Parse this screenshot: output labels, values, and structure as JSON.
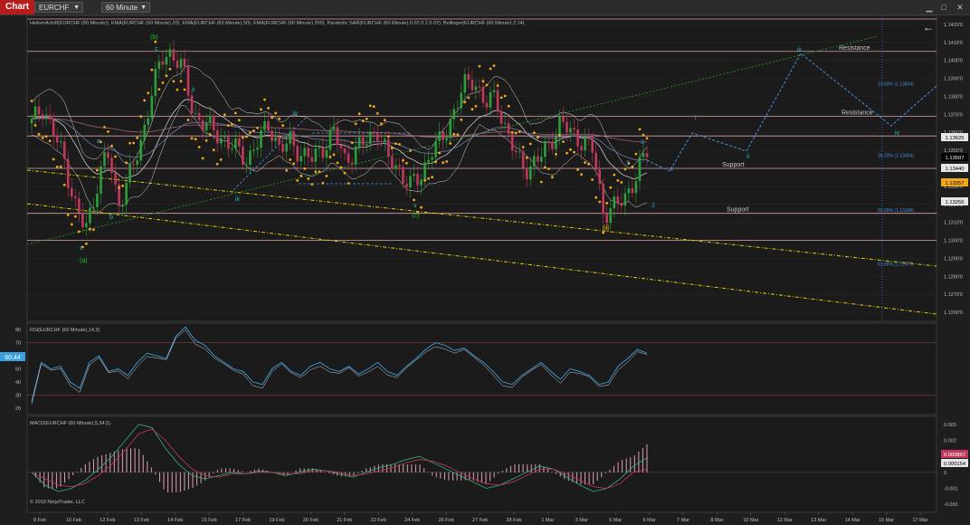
{
  "toolbar": {
    "tab_label": "Chart",
    "instrument": "EURCHF",
    "timeframe": "60 Minute"
  },
  "colors": {
    "background": "#1e1e1e",
    "grid": "#2c2c2c",
    "up_candle": "#2e9e3a",
    "down_candle": "#c0395a",
    "sar": "#f2a81d",
    "bollinger": "#d8d8d8",
    "ema20": "#c8c8c8",
    "ema50": "#6a7fb0",
    "ema200": "#9a6070",
    "resistance_line": "#d9a3a8",
    "trend_green": "#22a022",
    "trend_yellow": "#e0d000",
    "projection": "#4a8fe0",
    "rsi_line": "#3aa0e0",
    "macd_line": "#3ab07a",
    "macd_signal": "#c0395a"
  },
  "chart_data": [
    {
      "type": "line",
      "title": "HeikenAshi8(EURCHF (60 Minute)), EMA(EURCHF (60 Minute),20), EMA(EURCHF (60 Minute),50), EMA(EURCHF (60 Minute),200), Parabolic SAR(EURCHF (60 Minute),0.02,0.2,0.02), Bollinger(EURCHF (60 Minute),2,14)",
      "ylim": [
        1.1255,
        1.1425
      ],
      "y_ticks": [
        "1.1420'0",
        "1.1410'0",
        "1.1400'0",
        "1.1390'0",
        "1.1380'0",
        "1.1370'0",
        "1.1360'0",
        "1.1350'0",
        "1.1340'0",
        "1.1330'0",
        "1.1320'0",
        "1.1310'0",
        "1.1300'0",
        "1.1290'0",
        "1.1280'0",
        "1.1270'0",
        "1.1260'0"
      ],
      "x_ticks": [
        "8 Feb",
        "10 Feb",
        "12 Feb",
        "13 Feb",
        "14 Feb",
        "15 Feb",
        "17 Feb",
        "19 Feb",
        "20 Feb",
        "21 Feb",
        "22 Feb",
        "24 Feb",
        "26 Feb",
        "27 Feb",
        "28 Feb",
        "1 Mar",
        "3 Mar",
        "5 Mar",
        "6 Mar",
        "7 Mar",
        "8 Mar",
        "10 Mar",
        "12 Mar",
        "13 Mar",
        "14 Mar",
        "15 Mar",
        "17 Mar"
      ],
      "price_path": [
        [
          0,
          1.1365
        ],
        [
          2,
          1.1375
        ],
        [
          4,
          1.136
        ],
        [
          6,
          1.1345
        ],
        [
          8,
          1.132
        ],
        [
          9,
          1.1305
        ],
        [
          10,
          1.133
        ],
        [
          11,
          1.135
        ],
        [
          12,
          1.132
        ],
        [
          13,
          1.1335
        ],
        [
          14,
          1.135
        ],
        [
          15,
          1.138
        ],
        [
          16,
          1.14
        ],
        [
          17,
          1.1405
        ],
        [
          18,
          1.1395
        ],
        [
          19,
          1.137
        ],
        [
          20,
          1.1365
        ],
        [
          21,
          1.136
        ],
        [
          22,
          1.1355
        ],
        [
          23,
          1.135
        ],
        [
          24,
          1.1345
        ],
        [
          25,
          1.1355
        ],
        [
          26,
          1.1365
        ],
        [
          27,
          1.135
        ],
        [
          28,
          1.1355
        ],
        [
          29,
          1.1348
        ],
        [
          30,
          1.1345
        ],
        [
          31,
          1.1352
        ],
        [
          32,
          1.136
        ],
        [
          33,
          1.1345
        ],
        [
          34,
          1.135
        ],
        [
          35,
          1.1355
        ],
        [
          36,
          1.1362
        ],
        [
          37,
          1.1345
        ],
        [
          38,
          1.134
        ],
        [
          39,
          1.133
        ],
        [
          40,
          1.1335
        ],
        [
          41,
          1.135
        ],
        [
          42,
          1.1355
        ],
        [
          43,
          1.137
        ],
        [
          44,
          1.1385
        ],
        [
          45,
          1.139
        ],
        [
          46,
          1.1375
        ],
        [
          47,
          1.138
        ],
        [
          48,
          1.136
        ],
        [
          49,
          1.1345
        ],
        [
          50,
          1.134
        ],
        [
          51,
          1.1345
        ],
        [
          52,
          1.1355
        ],
        [
          53,
          1.1365
        ],
        [
          54,
          1.136
        ],
        [
          55,
          1.1355
        ],
        [
          56,
          1.135
        ],
        [
          57,
          1.1315
        ],
        [
          58,
          1.1318
        ],
        [
          59,
          1.1325
        ],
        [
          60,
          1.1335
        ],
        [
          61,
          1.135
        ]
      ],
      "horizontal_levels": [
        {
          "price": 1.1423,
          "label": ""
        },
        {
          "price": 1.1405,
          "label": "Resistance"
        },
        {
          "price": 1.1385,
          "label": "23.60% (1.13834)"
        },
        {
          "price": 1.1369,
          "label": "Resistance"
        },
        {
          "price": 1.1358,
          "label": ""
        },
        {
          "price": 1.13454,
          "label": "38.20% (1.13454)"
        },
        {
          "price": 1.134,
          "label": "Support"
        },
        {
          "price": 1.13148,
          "label": "50.00% (1.13148)"
        },
        {
          "price": 1.1315,
          "label": "Support"
        },
        {
          "price": 1.13,
          "label": ""
        },
        {
          "price": 1.1285,
          "label": "61.80% (1.12877)"
        }
      ],
      "price_labels": [
        {
          "value": "1.13625",
          "bg": "#e6e6e6",
          "fg": "#000000"
        },
        {
          "value": "1.13507",
          "bg": "#000000",
          "fg": "#ffffff"
        },
        {
          "value": "1.13440",
          "bg": "#e6e6e6",
          "fg": "#000000"
        },
        {
          "value": "1.13357",
          "bg": "#f2a81d",
          "fg": "#000000"
        },
        {
          "value": "1.13255",
          "bg": "#e6e6e6",
          "fg": "#000000"
        }
      ],
      "wave_labels": [
        {
          "text": "(b)",
          "color": "#22c022"
        },
        {
          "text": "c",
          "color": "#22c0c0"
        },
        {
          "text": "ii",
          "color": "#22c0c0"
        },
        {
          "text": "a",
          "color": "#22c0c0"
        },
        {
          "text": "b",
          "color": "#22c0c0"
        },
        {
          "text": "c",
          "color": "#22c0c0"
        },
        {
          "text": "(a)",
          "color": "#22c022"
        },
        {
          "text": "iv",
          "color": "#22c0c0"
        },
        {
          "text": "iii",
          "color": "#22c0c0"
        },
        {
          "text": "v",
          "color": "#22c0c0"
        },
        {
          "text": "(c)",
          "color": "#22c022"
        },
        {
          "text": "[ii]",
          "color": "#e0d000"
        },
        {
          "text": "i",
          "color": "#4a8fe0"
        },
        {
          "text": "ii",
          "color": "#22c0c0"
        },
        {
          "text": "iii",
          "color": "#22c0c0"
        },
        {
          "text": "iv",
          "color": "#22c0c0"
        },
        {
          "text": "3",
          "color": "#4a8fe0"
        },
        {
          "text": "4",
          "color": "#4a8fe0"
        },
        {
          "text": "2",
          "color": "#4a8fe0"
        },
        {
          "text": "1",
          "color": "#4a8fe0"
        }
      ]
    },
    {
      "type": "line",
      "title": "RSI(EURCHF (60 Minute),14,3)",
      "ylim": [
        15,
        85
      ],
      "y_ticks": [
        "80",
        "70",
        "60",
        "50",
        "40",
        "30",
        "20"
      ],
      "levels": [
        70,
        30
      ],
      "current_value": "60.44",
      "series": [
        {
          "values": [
            25,
            55,
            50,
            52,
            40,
            35,
            55,
            60,
            48,
            50,
            45,
            55,
            62,
            60,
            58,
            75,
            82,
            72,
            68,
            60,
            55,
            50,
            48,
            40,
            38,
            50,
            55,
            48,
            45,
            52,
            55,
            50,
            48,
            52,
            46,
            50,
            55,
            48,
            45,
            52,
            58,
            65,
            70,
            68,
            64,
            66,
            60,
            55,
            48,
            40,
            38,
            45,
            50,
            55,
            48,
            42,
            50,
            48,
            45,
            38,
            40,
            52,
            58,
            65,
            62
          ]
        }
      ]
    },
    {
      "type": "line",
      "title": "MACD(EURCHF (60 Minute),5,34,5)",
      "ylim": [
        -0.0025,
        0.0035
      ],
      "y_ticks": [
        "0.003",
        "0.002",
        "0.001",
        "0",
        "-0.001",
        "-0.002"
      ],
      "current_values": [
        {
          "value": "0.000897",
          "bg": "#c0395a",
          "fg": "#ffffff"
        },
        {
          "value": "0.000154",
          "bg": "#e6e6e6",
          "fg": "#000000"
        }
      ],
      "series": [
        {
          "values": [
            0.0,
            -0.0008,
            -0.0012,
            -0.001,
            -0.0005,
            0.0002,
            0.001,
            0.002,
            0.003,
            0.0028,
            0.0015,
            0.0005,
            -0.0002,
            -0.0004,
            -0.0002,
            0.0,
            -0.0001,
            0.0001,
            0.0,
            -0.0002,
            0.0,
            0.0002,
            0.0001,
            -0.0001,
            -0.0003,
            0.0,
            0.0003,
            0.0005,
            0.0008,
            0.001,
            0.0006,
            0.0002,
            -0.0002,
            -0.0006,
            -0.001,
            -0.0008,
            -0.0004,
            0.0,
            0.0004,
            0.0002,
            -0.0003,
            -0.0008,
            -0.0012,
            -0.001,
            -0.0004,
            0.0004,
            0.0009
          ]
        },
        {
          "values": [
            0.0,
            -0.0004,
            -0.0008,
            -0.0009,
            -0.0007,
            -0.0002,
            0.0005,
            0.0014,
            0.0024,
            0.0027,
            0.002,
            0.001,
            0.0002,
            -0.0002,
            -0.0003,
            -0.0001,
            -0.0001,
            0.0,
            0.0,
            -0.0001,
            -0.0001,
            0.0001,
            0.0001,
            0.0,
            -0.0002,
            -0.0001,
            0.0001,
            0.0003,
            0.0006,
            0.0008,
            0.0007,
            0.0004,
            0.0,
            -0.0004,
            -0.0007,
            -0.0008,
            -0.0006,
            -0.0002,
            0.0002,
            0.0002,
            -0.0001,
            -0.0005,
            -0.0009,
            -0.001,
            -0.0007,
            0.0,
            0.0002
          ]
        }
      ]
    }
  ],
  "footer": {
    "copyright": "© 2019 NinjaTrader, LLC"
  }
}
